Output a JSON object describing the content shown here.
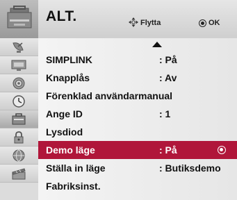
{
  "header": {
    "icon": "option-menu-icon",
    "title": "ALT.",
    "hint_move_icon": "four-way-arrows-icon",
    "hint_move": "Flytta",
    "hint_ok_icon": "ok-circle-icon",
    "hint_ok": "OK"
  },
  "sidebar": {
    "items": [
      {
        "icon": "satellite-dish-icon"
      },
      {
        "icon": "monitor-picture-icon"
      },
      {
        "icon": "speaker-audio-icon"
      },
      {
        "icon": "clock-time-icon"
      },
      {
        "icon": "option-briefcase-icon",
        "active": true
      },
      {
        "icon": "padlock-icon"
      },
      {
        "icon": "globe-network-icon"
      },
      {
        "icon": "clapperboard-media-icon"
      }
    ]
  },
  "menu": {
    "items": [
      {
        "label": "SIMPLINK",
        "value": ": På"
      },
      {
        "label": "Knapplås",
        "value": ": Av"
      },
      {
        "label": "Förenklad användarmanual",
        "value": ""
      },
      {
        "label": "Ange ID",
        "value": ": 1"
      },
      {
        "label": "Lysdiod",
        "value": ""
      },
      {
        "label": "Demo läge",
        "value": ": På",
        "selected": true
      },
      {
        "label": "Ställa in läge",
        "value": ": Butiksdemo"
      },
      {
        "label": "Fabriksinst.",
        "value": ""
      }
    ]
  },
  "colors": {
    "selection": "#b0163a",
    "header_bg": "#dcdcdc",
    "menu_bg": "#f0f0f0"
  }
}
